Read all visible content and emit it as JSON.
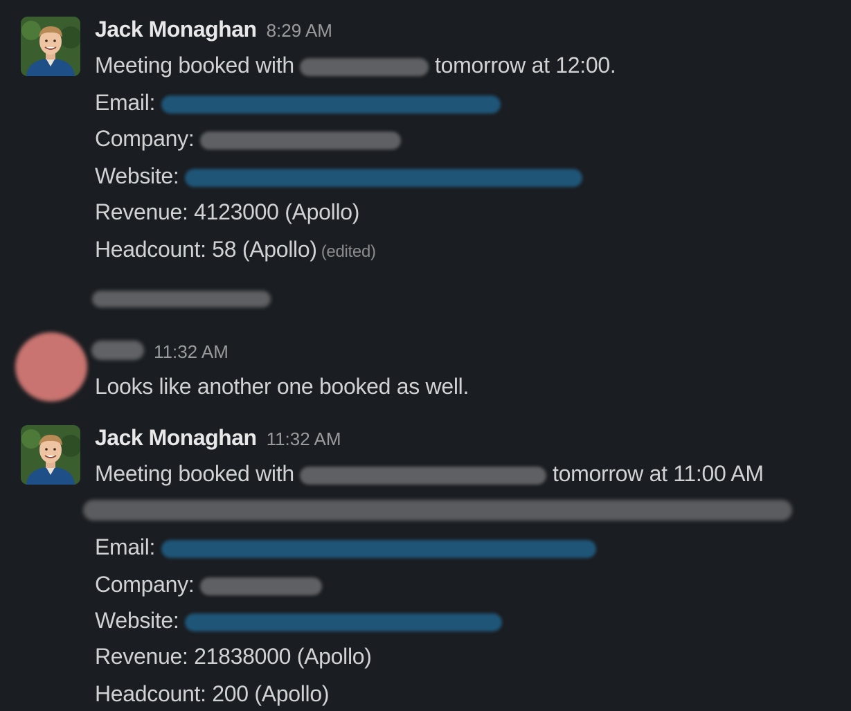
{
  "messages": [
    {
      "sender": "Jack Monaghan",
      "time": "8:29 AM",
      "line1_pre": "Meeting booked with",
      "line1_post": "tomorrow at 12:00.",
      "email_label": "Email:",
      "company_label": "Company:",
      "website_label": "Website:",
      "revenue": "Revenue: 4123000 (Apollo)",
      "headcount": "Headcount: 58 (Apollo)",
      "edited": "(edited)"
    },
    {
      "time": "11:32 AM",
      "text": "Looks like another one booked as well."
    },
    {
      "sender": "Jack Monaghan",
      "time": "11:32 AM",
      "line1_pre": "Meeting booked with",
      "line1_post": "tomorrow at 11:00 AM",
      "email_label": "Email:",
      "company_label": "Company:",
      "website_label": "Website:",
      "revenue": "Revenue: 21838000 (Apollo)",
      "headcount": "Headcount: 200 (Apollo)"
    }
  ],
  "colors": {
    "background": "#1a1d21",
    "text": "#d1d2d3",
    "timestamp": "#9a9b9d",
    "redaction_gray": "#5e6063",
    "redaction_blue": "#1f5678"
  }
}
